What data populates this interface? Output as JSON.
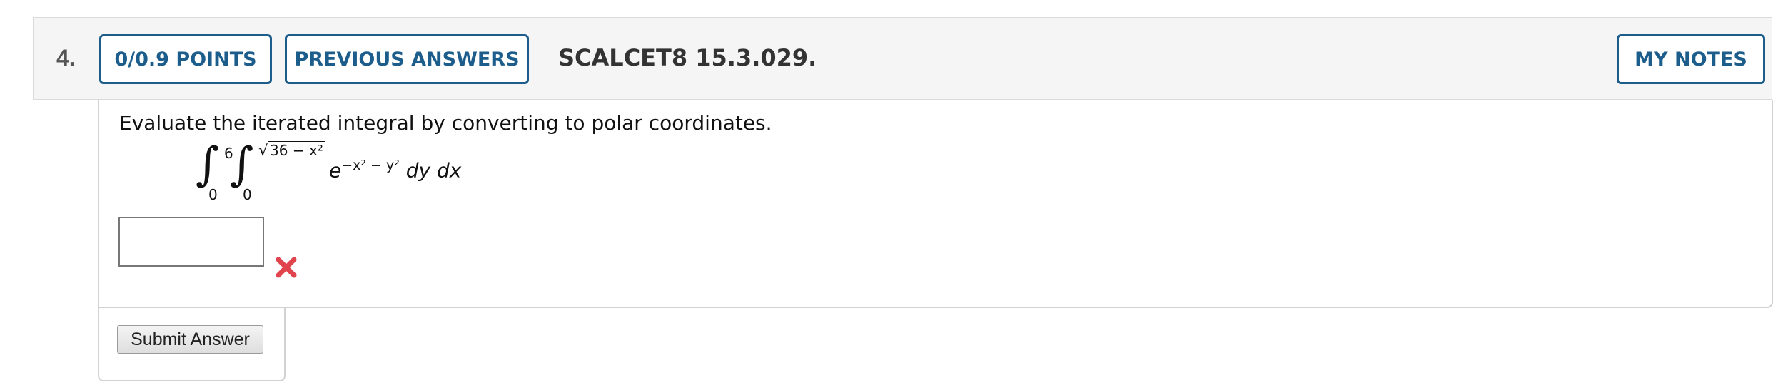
{
  "question": {
    "number": "4.",
    "points_label": "0/0.9 POINTS",
    "previous_answers_label": "PREVIOUS ANSWERS",
    "reference": "SCALCET8 15.3.029.",
    "my_notes_label": "MY NOTES"
  },
  "prompt": "Evaluate the iterated integral by converting to polar coordinates.",
  "math": {
    "outer_upper": "6",
    "outer_lower": "0",
    "inner_upper_radicand": "36 − x²",
    "inner_lower": "0",
    "integrand_base": "e",
    "integrand_exponent": "−x² − y²",
    "differentials": "dy dx"
  },
  "answer": {
    "value": "",
    "status": "incorrect",
    "status_color": "#e0454e"
  },
  "submit_label": "Submit Answer",
  "colors": {
    "accent": "#1c5d8c",
    "header_bg": "#f5f5f5"
  },
  "icons": {
    "status": "x-mark-icon",
    "integral": "integral-sign-icon"
  }
}
